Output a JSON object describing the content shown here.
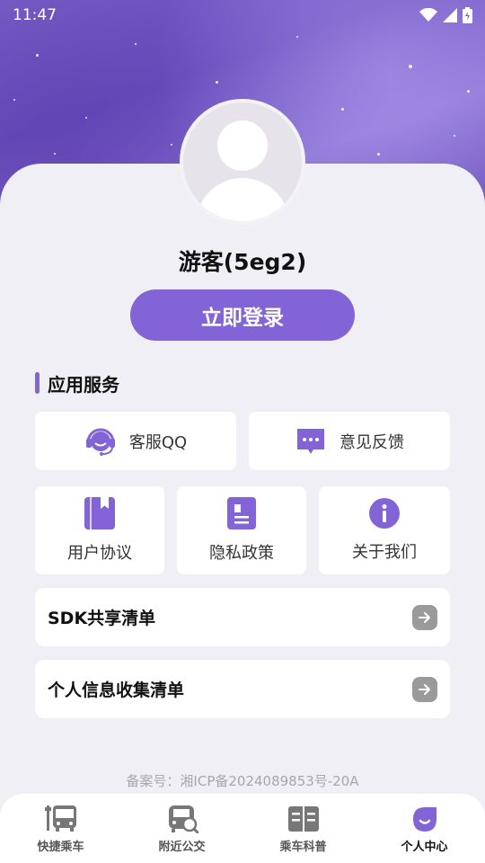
{
  "status_bar": {
    "time": "11:47"
  },
  "profile": {
    "username": "游客(5eg2)",
    "login_label": "立即登录"
  },
  "services": {
    "title": "应用服务",
    "wide": [
      {
        "label": "客服QQ",
        "icon": "customer-service-icon"
      },
      {
        "label": "意见反馈",
        "icon": "chat-bubble-icon"
      }
    ],
    "small": [
      {
        "label": "用户协议",
        "icon": "book-icon"
      },
      {
        "label": "隐私政策",
        "icon": "document-icon"
      },
      {
        "label": "关于我们",
        "icon": "info-icon"
      }
    ]
  },
  "lists": [
    {
      "label": "SDK共享清单"
    },
    {
      "label": "个人信息收集清单"
    }
  ],
  "footer": {
    "icp": "备案号：湘ICP备2024089853号-20A"
  },
  "tabs": [
    {
      "label": "快捷乘车",
      "icon": "bus-icon",
      "active": false
    },
    {
      "label": "附近公交",
      "icon": "bus-search-icon",
      "active": false
    },
    {
      "label": "乘车科普",
      "icon": "open-book-icon",
      "active": false
    },
    {
      "label": "个人中心",
      "icon": "person-blob-icon",
      "active": true
    }
  ],
  "colors": {
    "accent": "#8364d6",
    "background": "#f1eff6",
    "arrow": "#9a9a9a"
  }
}
